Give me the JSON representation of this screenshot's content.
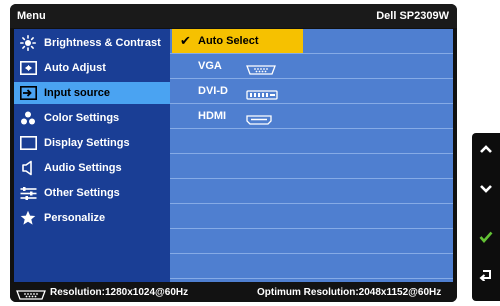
{
  "title": {
    "left": "Menu",
    "right": "Dell SP2309W"
  },
  "menu": [
    {
      "label": "Brightness & Contrast",
      "icon": "brightness-icon"
    },
    {
      "label": "Auto Adjust",
      "icon": "auto-adjust-icon"
    },
    {
      "label": "Input source",
      "icon": "input-source-icon",
      "selected": true
    },
    {
      "label": "Color Settings",
      "icon": "color-settings-icon"
    },
    {
      "label": "Display Settings",
      "icon": "display-settings-icon"
    },
    {
      "label": "Audio Settings",
      "icon": "audio-icon"
    },
    {
      "label": "Other Settings",
      "icon": "other-settings-icon"
    },
    {
      "label": "Personalize",
      "icon": "star-icon"
    }
  ],
  "options": [
    {
      "label": "Auto Select",
      "active": true
    },
    {
      "label": "VGA",
      "icon": "vga-connector-icon"
    },
    {
      "label": "DVI-D",
      "icon": "dvi-connector-icon"
    },
    {
      "label": "HDMI",
      "icon": "hdmi-connector-icon"
    }
  ],
  "status": {
    "resolution": "Resolution:1280x1024@60Hz",
    "optimum": "Optimum Resolution:2048x1152@60Hz"
  },
  "side_buttons": [
    "up-arrow-icon",
    "down-arrow-icon",
    "checkmark-icon",
    "back-icon"
  ],
  "colors": {
    "panel": "#4f7fd0",
    "menu_bg": "#1a3e95",
    "menu_selected": "#4aa3f2",
    "active_option": "#f6c100",
    "confirm_green": "#63c235"
  }
}
